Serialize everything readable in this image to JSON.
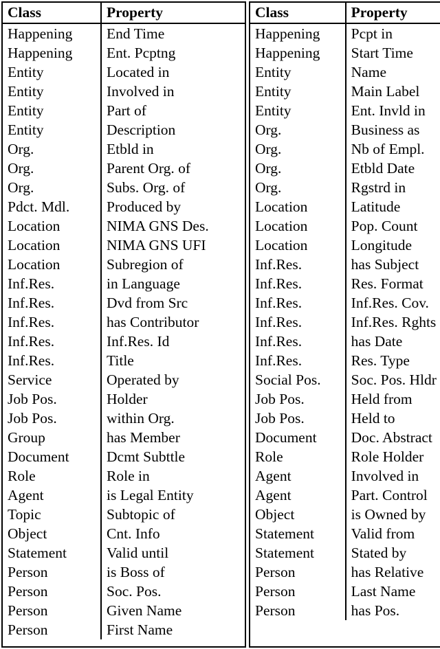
{
  "table": {
    "headers": [
      "Class",
      "Property",
      "Class",
      "Property"
    ],
    "left": {
      "headers": {
        "class": "Class",
        "property": "Property"
      },
      "rows": [
        {
          "class": "Happening",
          "property": "End Time"
        },
        {
          "class": "Happening",
          "property": "Ent. Pcptng"
        },
        {
          "class": "Entity",
          "property": "Located in"
        },
        {
          "class": "Entity",
          "property": "Involved in"
        },
        {
          "class": "Entity",
          "property": "Part of"
        },
        {
          "class": "Entity",
          "property": "Description"
        },
        {
          "class": "Org.",
          "property": "Etbld in"
        },
        {
          "class": "Org.",
          "property": "Parent Org. of"
        },
        {
          "class": "Org.",
          "property": "Subs. Org. of"
        },
        {
          "class": "Pdct. Mdl.",
          "property": "Produced by"
        },
        {
          "class": "Location",
          "property": "NIMA GNS Des."
        },
        {
          "class": "Location",
          "property": "NIMA GNS UFI"
        },
        {
          "class": "Location",
          "property": "Subregion of"
        },
        {
          "class": "Inf.Res.",
          "property": "in Language"
        },
        {
          "class": "Inf.Res.",
          "property": "Dvd from Src"
        },
        {
          "class": "Inf.Res.",
          "property": "has Contributor"
        },
        {
          "class": "Inf.Res.",
          "property": "Inf.Res. Id"
        },
        {
          "class": "Inf.Res.",
          "property": "Title"
        },
        {
          "class": "Service",
          "property": "Operated by"
        },
        {
          "class": "Job Pos.",
          "property": "Holder"
        },
        {
          "class": "Job Pos.",
          "property": "within Org."
        },
        {
          "class": "Group",
          "property": "has Member"
        },
        {
          "class": "Document",
          "property": "Dcmt Subttle"
        },
        {
          "class": "Role",
          "property": "Role in"
        },
        {
          "class": "Agent",
          "property": "is Legal Entity"
        },
        {
          "class": "Topic",
          "property": "Subtopic of"
        },
        {
          "class": "Object",
          "property": "Cnt. Info"
        },
        {
          "class": "Statement",
          "property": "Valid until"
        },
        {
          "class": "Person",
          "property": "is Boss of"
        },
        {
          "class": "Person",
          "property": "Soc. Pos."
        },
        {
          "class": "Person",
          "property": "Given Name"
        },
        {
          "class": "Person",
          "property": "First Name"
        }
      ]
    },
    "right": {
      "headers": {
        "class": "Class",
        "property": "Property"
      },
      "rows": [
        {
          "class": "Happening",
          "property": "Pcpt in"
        },
        {
          "class": "Happening",
          "property": "Start Time"
        },
        {
          "class": "Entity",
          "property": "Name"
        },
        {
          "class": "Entity",
          "property": "Main Label"
        },
        {
          "class": "Entity",
          "property": "Ent. Invld in"
        },
        {
          "class": "Org.",
          "property": "Business as"
        },
        {
          "class": "Org.",
          "property": "Nb of Empl."
        },
        {
          "class": "Org.",
          "property": "Etbld Date"
        },
        {
          "class": "Org.",
          "property": "Rgstrd in"
        },
        {
          "class": "Location",
          "property": "Latitude"
        },
        {
          "class": "Location",
          "property": "Pop. Count"
        },
        {
          "class": "Location",
          "property": "Longitude"
        },
        {
          "class": "Inf.Res.",
          "property": "has Subject"
        },
        {
          "class": "Inf.Res.",
          "property": "Res. Format"
        },
        {
          "class": "Inf.Res.",
          "property": "Inf.Res. Cov."
        },
        {
          "class": "Inf.Res.",
          "property": "Inf.Res. Rghts"
        },
        {
          "class": "Inf.Res.",
          "property": "has Date"
        },
        {
          "class": "Inf.Res.",
          "property": "Res. Type"
        },
        {
          "class": "Social Pos.",
          "property": "Soc. Pos. Hldr"
        },
        {
          "class": "Job Pos.",
          "property": "Held from"
        },
        {
          "class": "Job Pos.",
          "property": "Held to"
        },
        {
          "class": "Document",
          "property": "Doc. Abstract"
        },
        {
          "class": "Role",
          "property": "Role Holder"
        },
        {
          "class": "Agent",
          "property": "Involved in"
        },
        {
          "class": "Agent",
          "property": "Part. Control"
        },
        {
          "class": "Object",
          "property": "is Owned by"
        },
        {
          "class": "Statement",
          "property": "Valid from"
        },
        {
          "class": "Statement",
          "property": "Stated by"
        },
        {
          "class": "Person",
          "property": "has Relative"
        },
        {
          "class": "Person",
          "property": "Last Name"
        },
        {
          "class": "Person",
          "property": "has Pos."
        }
      ]
    }
  }
}
